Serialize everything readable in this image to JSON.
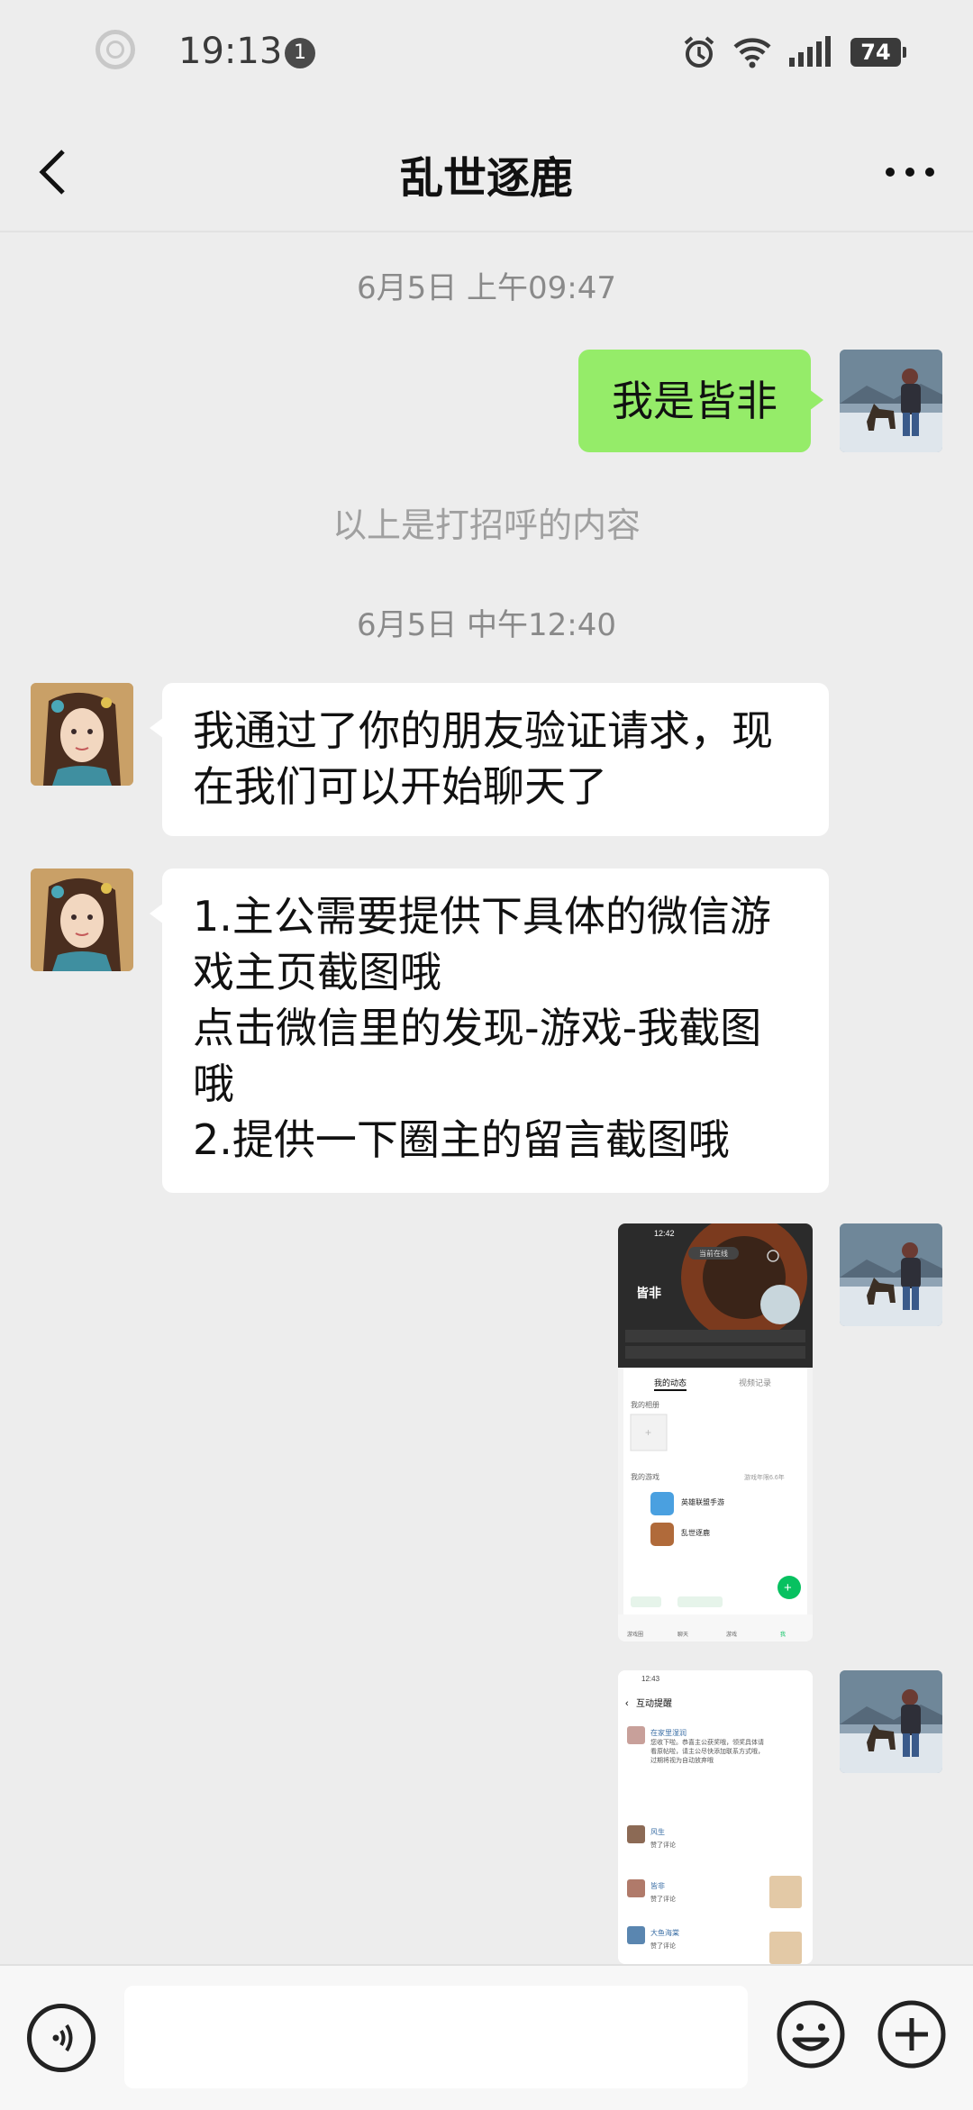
{
  "status_bar": {
    "time": "19:13",
    "notification_count": "1",
    "battery": "74"
  },
  "header": {
    "title": "乱世逐鹿"
  },
  "messages": {
    "ts1": "6月5日 上午09:47",
    "greeting_out": "我是皆非",
    "system_note": "以上是打招呼的内容",
    "ts2": "6月5日 中午12:40",
    "incoming1": "我通过了你的朋友验证请求，现\n在我们可以开始聊天了",
    "incoming2": "1.主公需要提供下具体的微信游\n戏主页截图哦\n点击微信里的发现-游戏-我截图\n哦\n2.提供一下圈主的留言截图哦"
  },
  "shot1": {
    "time": "12:42",
    "online": "当前在线",
    "name": "皆非",
    "tab_active": "我的动态",
    "tab_other": "视频记录",
    "section_album": "我的相册",
    "section_games": "我的游戏",
    "games_meta": "游戏年限6.6年",
    "game1": "英雄联盟手游",
    "game2": "乱世逐鹿",
    "nav": [
      "游戏圈",
      "聊天",
      "游戏",
      "我"
    ]
  },
  "shot2": {
    "time": "12:43",
    "title": "互动提醒",
    "item1_name": "在家里湿润",
    "item1_text": "您收下啦。恭喜主公获奖哦，领奖具体请看原帖啦，请主公尽快添加联系方式哦，过期将视为自动放弃哦",
    "item2_name": "风生",
    "item2_text": "赞了评论",
    "item3_name": "皆非",
    "item3_text": "赞了评论",
    "item4_name": "大鱼海棠",
    "item4_text": "赞了评论"
  },
  "colors": {
    "bubble_out": "#95ec69",
    "bubble_in": "#ffffff",
    "background": "#ededed"
  }
}
